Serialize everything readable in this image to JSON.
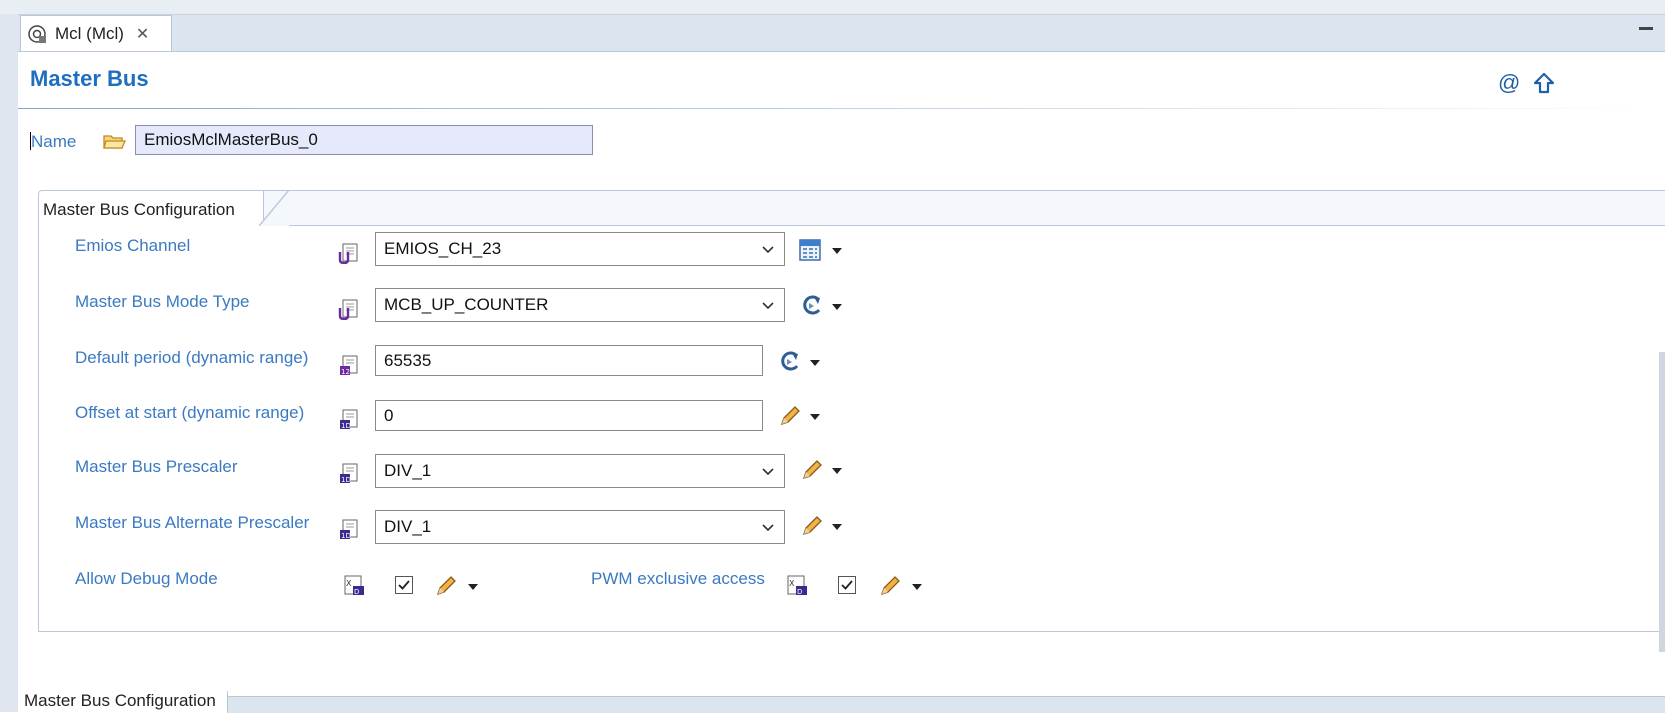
{
  "editor_tab": {
    "label": "Mcl (Mcl)",
    "icon": "module-config-icon"
  },
  "header": {
    "title": "Master Bus"
  },
  "name": {
    "label": "Name",
    "value": "EmiosMclMasterBus_0"
  },
  "group": {
    "tab_label": "Master Bus Configuration"
  },
  "fields": {
    "emios_channel": {
      "label": "Emios Channel",
      "value": "EMIOS_CH_23"
    },
    "mode_type": {
      "label": "Master Bus Mode Type",
      "value": "MCB_UP_COUNTER"
    },
    "default_period": {
      "label": "Default period (dynamic range)",
      "value": "65535"
    },
    "offset_start": {
      "label": "Offset at start (dynamic range)",
      "value": "0"
    },
    "prescaler": {
      "label": "Master Bus Prescaler",
      "value": "DIV_1"
    },
    "alt_prescaler": {
      "label": "Master Bus Alternate Prescaler",
      "value": "DIV_1"
    },
    "allow_debug": {
      "label": "Allow Debug Mode",
      "checked": true
    },
    "pwm_exclusive": {
      "label": "PWM exclusive access",
      "checked": true
    }
  },
  "bottom_tab": {
    "label": "Master Bus Configuration"
  },
  "colors": {
    "label_blue": "#3a7ac1",
    "title_blue": "#1f6fbf",
    "input_highlight": "#e6e8fb"
  }
}
